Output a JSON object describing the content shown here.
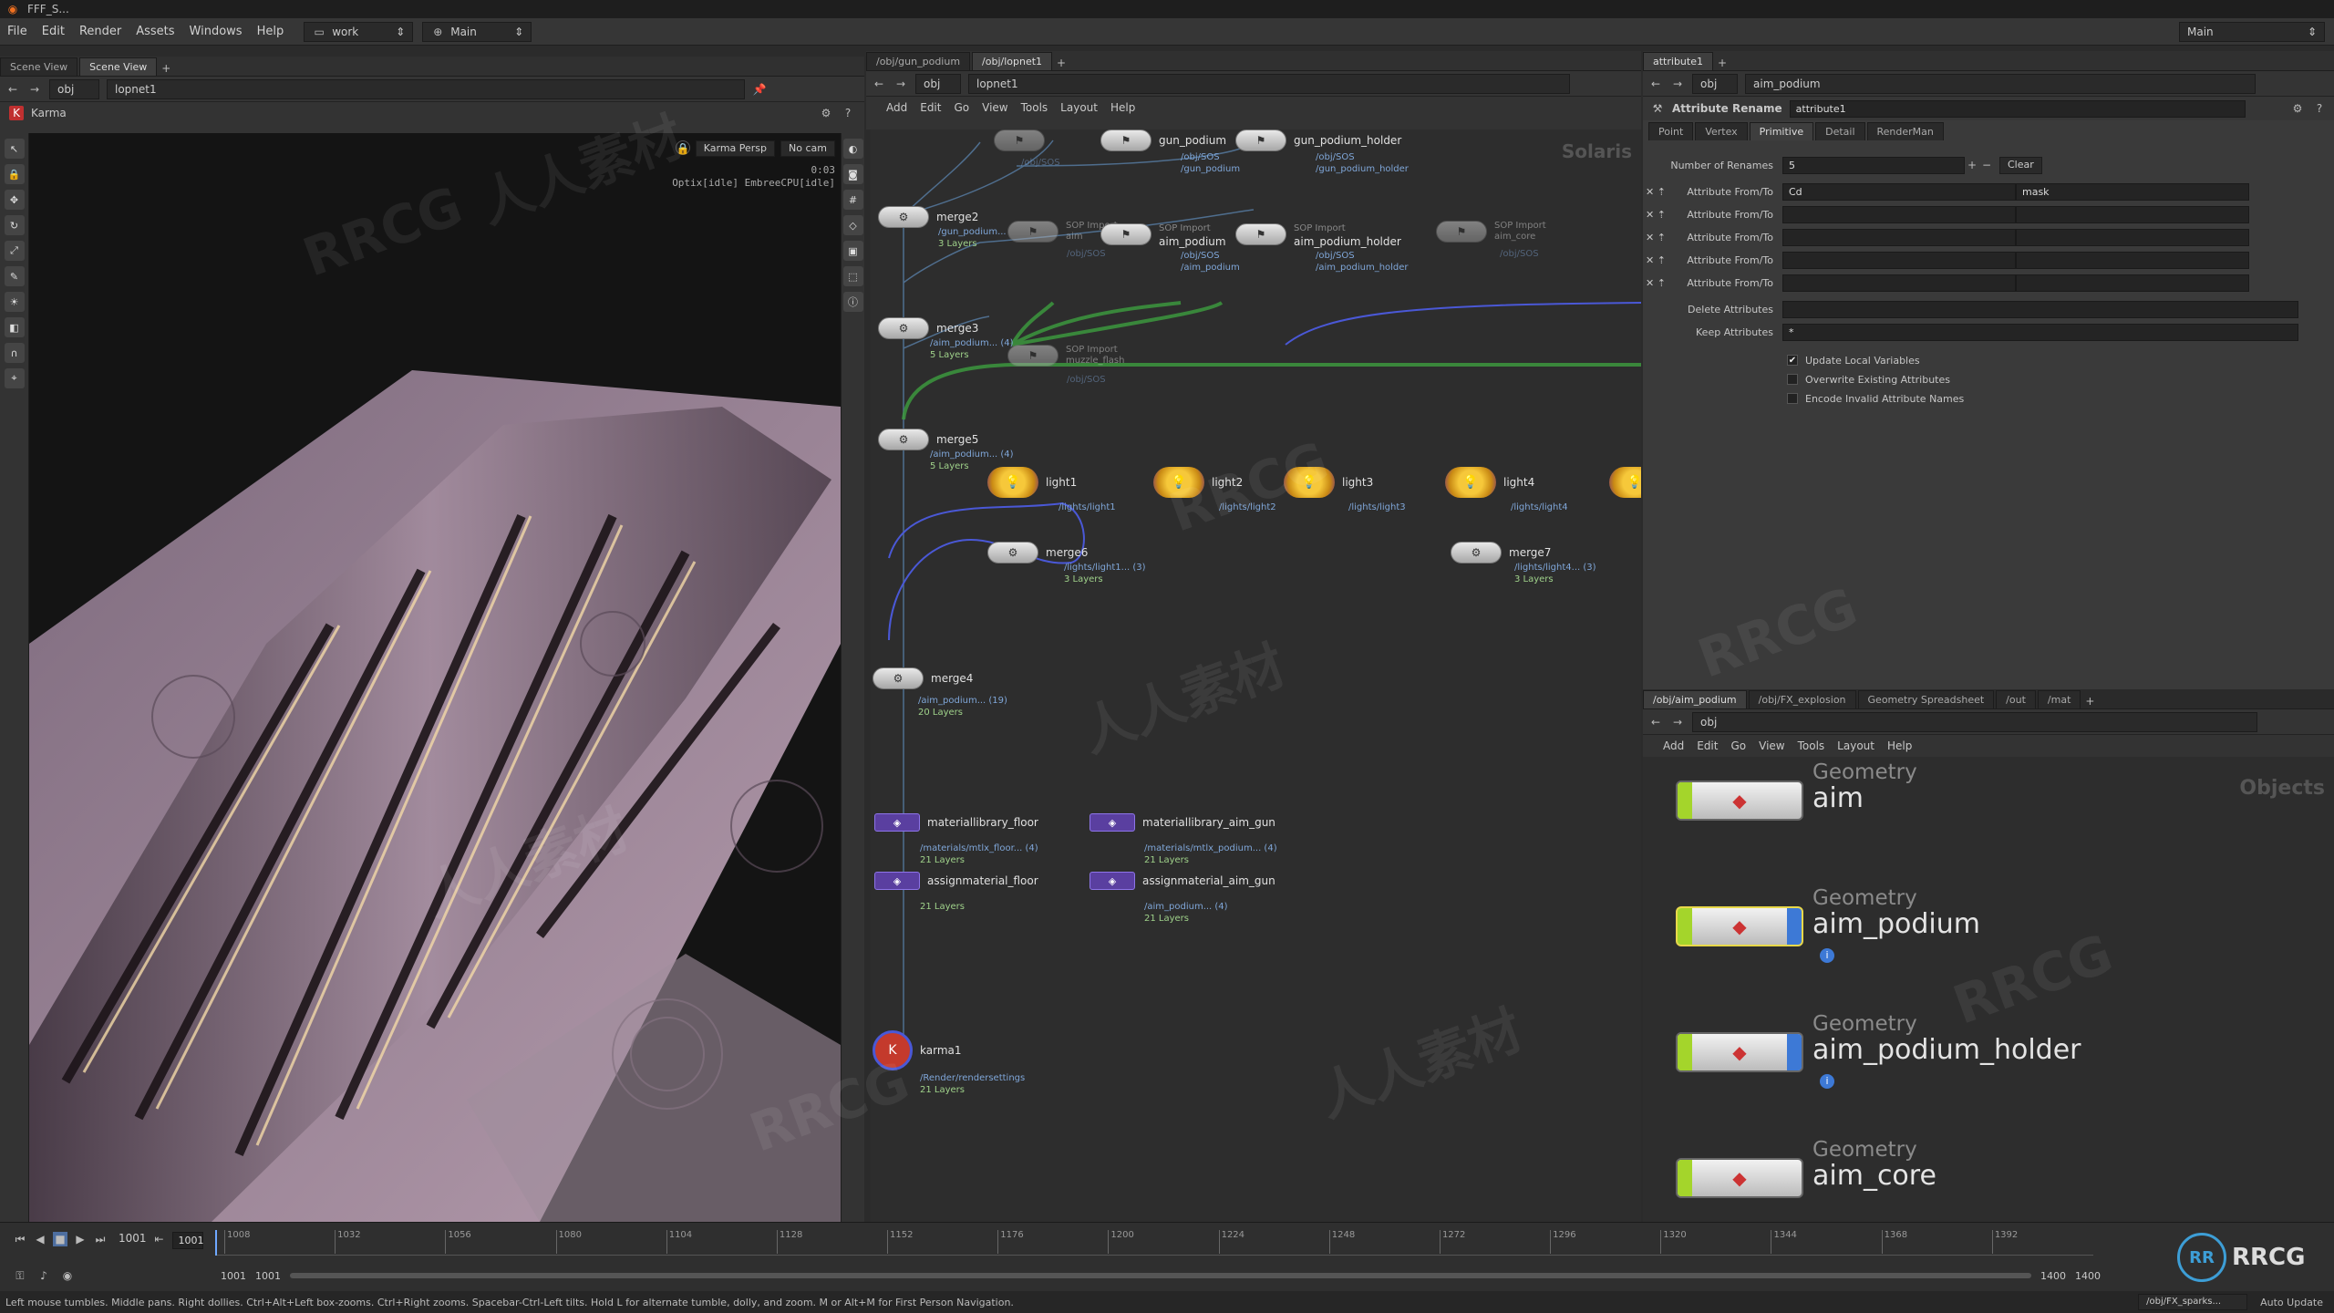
{
  "titlebar": {
    "title": "FFF_S..."
  },
  "menu": {
    "items": [
      "File",
      "Edit",
      "Render",
      "Assets",
      "Windows",
      "Help"
    ],
    "desktop": "work",
    "main": "Main",
    "main_right": "Main"
  },
  "scene_view": {
    "tabs": [
      "Scene View",
      "Scene View"
    ],
    "path": [
      "obj",
      "lopnet1"
    ],
    "renderer": "Karma",
    "camera_menu": "Karma Persp",
    "cam_menu": "No cam",
    "time": "0:03",
    "render_status": "Optix[idle] EmbreeCPU[idle]"
  },
  "network": {
    "tabs": [
      "/obj/gun_podium",
      "/obj/lopnet1"
    ],
    "path": [
      "obj",
      "lopnet1"
    ],
    "menu": [
      "Add",
      "Edit",
      "Go",
      "View",
      "Tools",
      "Layout",
      "Help"
    ],
    "context_label": "Solaris",
    "nodes": {
      "top_ghost1": "",
      "gun_podium": {
        "label": "gun_podium",
        "sub1": "/obj/SOS",
        "sub2": "/gun_podium"
      },
      "gun_podium_holder": {
        "label": "gun_podium_holder",
        "sub1": "/obj/SOS",
        "sub2": "/gun_podium_holder"
      },
      "top_sub_left": "/obj/SOS",
      "merge2": {
        "label": "merge2",
        "sub1": "/gun_podium...",
        "sub2": "3 Layers"
      },
      "sop_aim": {
        "type": "SOP Import",
        "label": "aim",
        "sub1": "/obj/SOS"
      },
      "aim_podium": {
        "type": "SOP Import",
        "label": "aim_podium",
        "sub1": "/obj/SOS",
        "sub2": "/aim_podium"
      },
      "aim_podium_holder": {
        "type": "SOP Import",
        "label": "aim_podium_holder",
        "sub1": "/obj/SOS",
        "sub2": "/aim_podium_holder"
      },
      "aim_core": {
        "type": "SOP Import",
        "label": "aim_core",
        "sub1": "/obj/SOS"
      },
      "merge3": {
        "label": "merge3",
        "sub1": "/aim_podium... (4)",
        "sub2": "5 Layers"
      },
      "muzzle_flash": {
        "type": "SOP Import",
        "label": "muzzle_flash",
        "sub1": "/obj/SOS"
      },
      "merge5": {
        "label": "merge5",
        "sub1": "/aim_podium... (4)",
        "sub2": "5 Layers"
      },
      "light1": {
        "label": "light1",
        "sub1": "/lights/light1"
      },
      "light2": {
        "label": "light2",
        "sub1": "/lights/light2"
      },
      "light3": {
        "label": "light3",
        "sub1": "/lights/light3"
      },
      "light4": {
        "label": "light4",
        "sub1": "/lights/light4"
      },
      "merge6": {
        "label": "merge6",
        "sub1": "/lights/light1... (3)",
        "sub2": "3 Layers"
      },
      "merge7": {
        "label": "merge7",
        "sub1": "/lights/light4... (3)",
        "sub2": "3 Layers"
      },
      "merge4": {
        "label": "merge4",
        "sub1": "/aim_podium... (19)",
        "sub2": "20 Layers"
      },
      "materiallibrary_floor": {
        "label": "materiallibrary_floor",
        "sub1": "/materials/mtlx_floor... (4)",
        "sub2": "21 Layers"
      },
      "assignmaterial_floor": {
        "label": "assignmaterial_floor",
        "sub2": "21 Layers"
      },
      "materiallibrary_aim_gun": {
        "label": "materiallibrary_aim_gun",
        "sub1": "/materials/mtlx_podium... (4)",
        "sub2": "21 Layers"
      },
      "assignmaterial_aim_gun": {
        "label": "assignmaterial_aim_gun",
        "sub1": "/aim_podium... (4)",
        "sub2": "21 Layers"
      },
      "karma1": {
        "label": "karma1",
        "sub1": "/Render/rendersettings",
        "sub2": "21 Layers"
      }
    }
  },
  "params": {
    "tab": "attribute1",
    "path": [
      "obj",
      "aim_podium"
    ],
    "node_type": "Attribute Rename",
    "node_name": "attribute1",
    "subtabs": [
      "Point",
      "Vertex",
      "Primitive",
      "Detail",
      "RenderMan"
    ],
    "num_renames_label": "Number of Renames",
    "num_renames": "5",
    "clear_label": "Clear",
    "rename_label": "Attribute From/To",
    "renames": [
      [
        "Cd",
        "mask"
      ],
      [
        "",
        ""
      ],
      [
        "",
        ""
      ],
      [
        "",
        ""
      ],
      [
        "",
        ""
      ]
    ],
    "delete_label": "Delete Attributes",
    "delete_value": "",
    "keep_label": "Keep Attributes",
    "keep_value": "*",
    "checks": [
      {
        "label": "Update Local Variables",
        "checked": true
      },
      {
        "label": "Overwrite Existing Attributes",
        "checked": false
      },
      {
        "label": "Encode Invalid Attribute Names",
        "checked": false
      }
    ]
  },
  "objnet": {
    "tabs": [
      "/obj/aim_podium",
      "/obj/FX_explosion",
      "Geometry Spreadsheet",
      "/out",
      "/mat"
    ],
    "path": "obj",
    "menu": [
      "Add",
      "Edit",
      "Go",
      "View",
      "Tools",
      "Layout",
      "Help"
    ],
    "context_label": "Objects",
    "nodes": [
      {
        "type": "Geometry",
        "name": "aim"
      },
      {
        "type": "Geometry",
        "name": "aim_podium"
      },
      {
        "type": "Geometry",
        "name": "aim_podium_holder"
      },
      {
        "type": "Geometry",
        "name": "aim_core"
      }
    ]
  },
  "timeline": {
    "ticks": [
      "1008",
      "1032",
      "1056",
      "1080",
      "1104",
      "1128",
      "1152",
      "1176",
      "1200",
      "1224",
      "1248",
      "1272",
      "1296",
      "1320",
      "1344",
      "1368",
      "1392"
    ],
    "current_frame": "1001",
    "frame_field": "1001",
    "range_start": "1001",
    "range_start2": "1001",
    "range_end": "1400",
    "range_end2": "1400"
  },
  "status": {
    "hint": "Left mouse tumbles. Middle pans. Right dollies. Ctrl+Alt+Left box-zooms. Ctrl+Right zooms. Spacebar-Ctrl-Left tilts. Hold L for alternate tumble, dolly, and zoom.    M or Alt+M for First Person Navigation.",
    "right_path": "/obj/FX_sparks...",
    "auto_update": "Auto Update"
  },
  "watermarks": [
    "RRCG",
    "人人素材"
  ]
}
